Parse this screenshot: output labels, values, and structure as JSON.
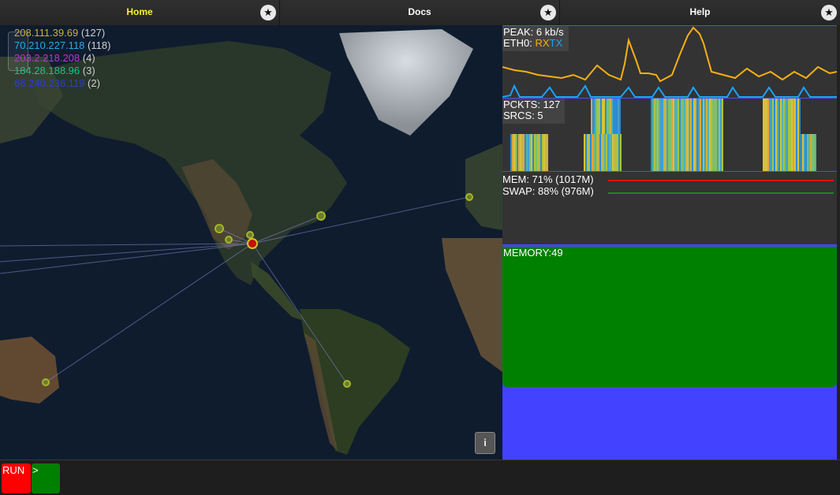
{
  "tabs": [
    {
      "label": "Home",
      "active": true,
      "star": "★"
    },
    {
      "label": "Docs",
      "active": false,
      "star": "★"
    },
    {
      "label": "Help",
      "active": false,
      "star": "★"
    }
  ],
  "map": {
    "ip_sources": [
      {
        "ip": "208.111.39.69",
        "count": "(127)",
        "color": "#c9b23a"
      },
      {
        "ip": "70.210.227.118",
        "count": "(118)",
        "color": "#2aa7e8"
      },
      {
        "ip": "203.2.218.208",
        "count": "(4)",
        "color": "#b23ad0"
      },
      {
        "ip": "184.28.188.96",
        "count": "(3)",
        "color": "#22c08a"
      },
      {
        "ip": "66.240.236.119",
        "count": "(2)",
        "color": "#2a3fcc"
      }
    ],
    "info_button": "i"
  },
  "network": {
    "peak_label": "PEAK: 6 kb/s",
    "iface_label": "ETH0:",
    "rx_label": "RX",
    "tx_label": "TX",
    "rx_color": "#f5b014",
    "tx_color": "#1aa4ff"
  },
  "packets": {
    "pckts_label": "PCKTS: 127",
    "srcs_label": "SRCS: 5"
  },
  "memory": {
    "mem_label": "MEM: 71% (1017M)",
    "swap_label": "SWAP: 88% (976M)",
    "mem_fraction": 0.71,
    "swap_fraction": 0.88,
    "mem_color": "#e01010",
    "swap_color": "#1a8a1a"
  },
  "memory_block": {
    "label": "MEMORY:49",
    "green_color": "#008000",
    "blue_color": "#4343ff"
  },
  "bottom": {
    "run_label": "RUN",
    "go_label": ">"
  }
}
